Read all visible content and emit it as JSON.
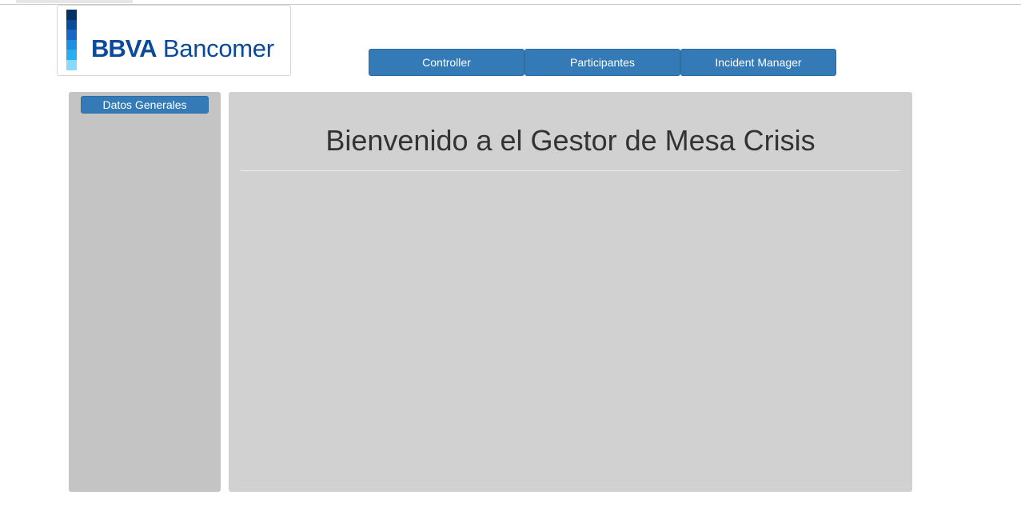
{
  "logo": {
    "brand_bold": "BBVA",
    "brand_regular": "Bancomer",
    "bar_colors": [
      "#043263",
      "#0a4b9b",
      "#1767c3",
      "#1d8fe0",
      "#27aff0",
      "#8ad9fb"
    ]
  },
  "nav": {
    "items": [
      {
        "label": "Controller"
      },
      {
        "label": "Participantes"
      },
      {
        "label": "Incident Manager"
      }
    ]
  },
  "sidebar": {
    "button_label": "Datos Generales"
  },
  "main": {
    "title": "Bienvenido a el Gestor de Mesa Crisis"
  },
  "colors": {
    "button_primary": "#337ab7",
    "sidebar_bg": "#c4c4c4",
    "main_bg": "#d1d1d1"
  }
}
